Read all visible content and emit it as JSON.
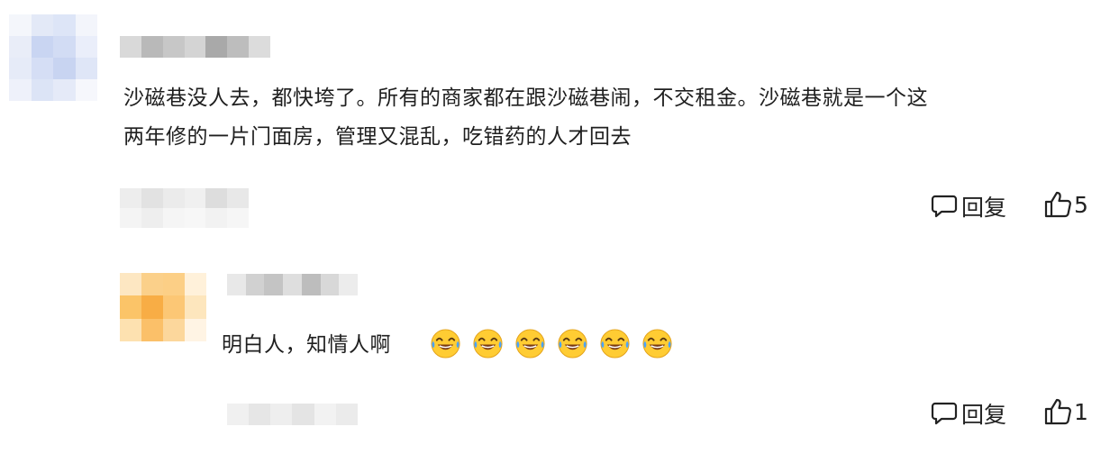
{
  "comments": [
    {
      "text_line1": "沙磁巷没人去，都快垮了。所有的商家都在跟沙磁巷闹，不交租金。沙磁巷就是一个这",
      "text_line2": "两年修的一片门面房，管理又混乱，吃错药的人才回去",
      "reply_label": "回复",
      "like_count": "5"
    },
    {
      "text": "明白人，知情人啊",
      "emojis": [
        "laugh-cry-emoji",
        "laugh-cry-emoji",
        "laugh-cry-emoji",
        "laugh-cry-emoji",
        "laugh-cry-emoji",
        "laugh-cry-emoji"
      ],
      "reply_label": "回复",
      "like_count": "1"
    }
  ]
}
